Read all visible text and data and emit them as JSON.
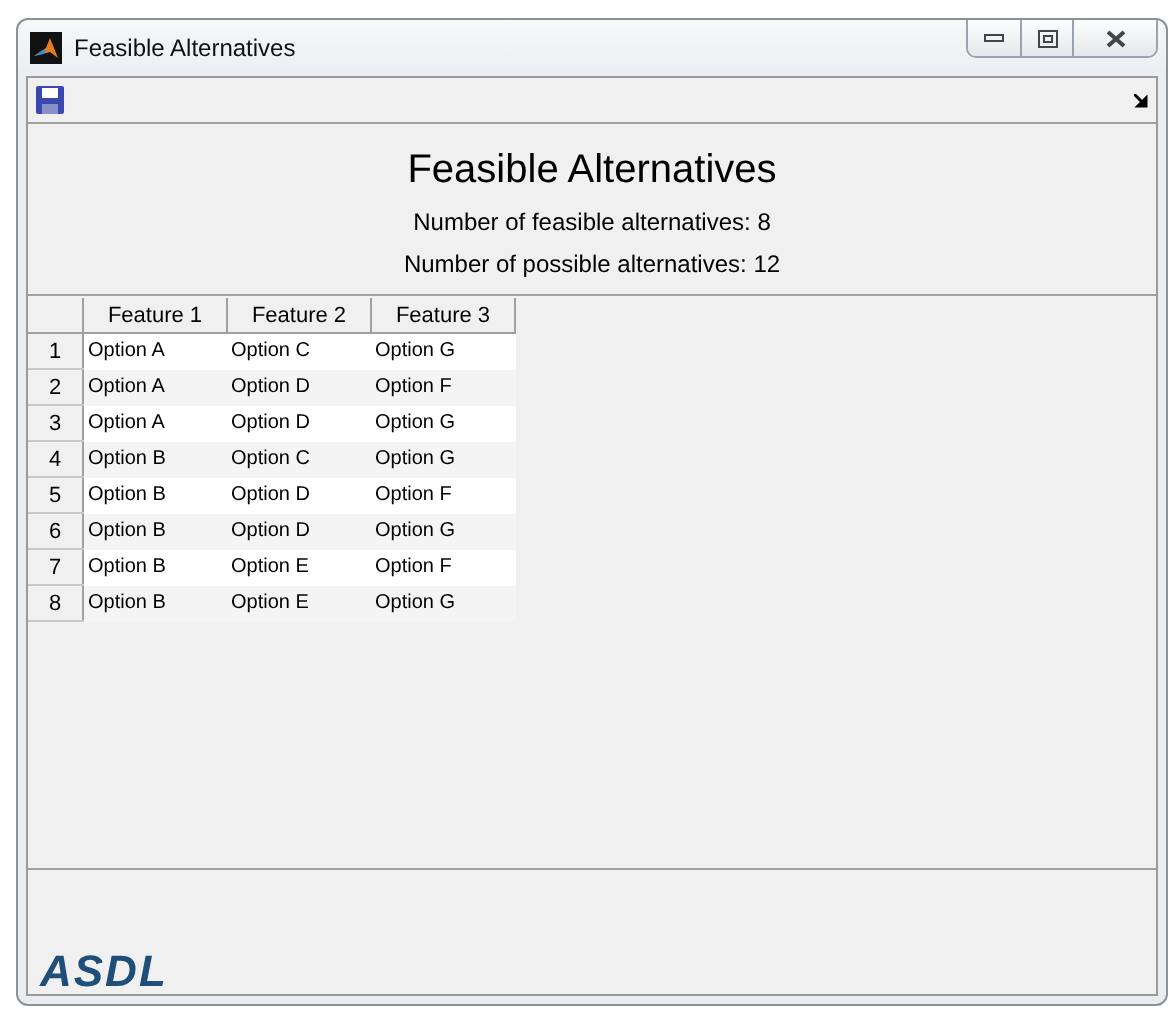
{
  "window": {
    "title": "Feasible Alternatives"
  },
  "heading": "Feasible Alternatives",
  "stats": [
    "Number of feasible alternatives: 8",
    "Number of possible alternatives: 12"
  ],
  "table": {
    "columns": [
      "Feature 1",
      "Feature 2",
      "Feature 3"
    ],
    "rows": [
      {
        "label": "1",
        "cells": [
          "Option A",
          "Option C",
          "Option G"
        ]
      },
      {
        "label": "2",
        "cells": [
          "Option A",
          "Option D",
          "Option F"
        ]
      },
      {
        "label": "3",
        "cells": [
          "Option A",
          "Option D",
          "Option G"
        ]
      },
      {
        "label": "4",
        "cells": [
          "Option B",
          "Option C",
          "Option G"
        ]
      },
      {
        "label": "5",
        "cells": [
          "Option B",
          "Option D",
          "Option F"
        ]
      },
      {
        "label": "6",
        "cells": [
          "Option B",
          "Option D",
          "Option G"
        ]
      },
      {
        "label": "7",
        "cells": [
          "Option B",
          "Option E",
          "Option F"
        ]
      },
      {
        "label": "8",
        "cells": [
          "Option B",
          "Option E",
          "Option G"
        ]
      }
    ]
  },
  "logo": "ASDL"
}
